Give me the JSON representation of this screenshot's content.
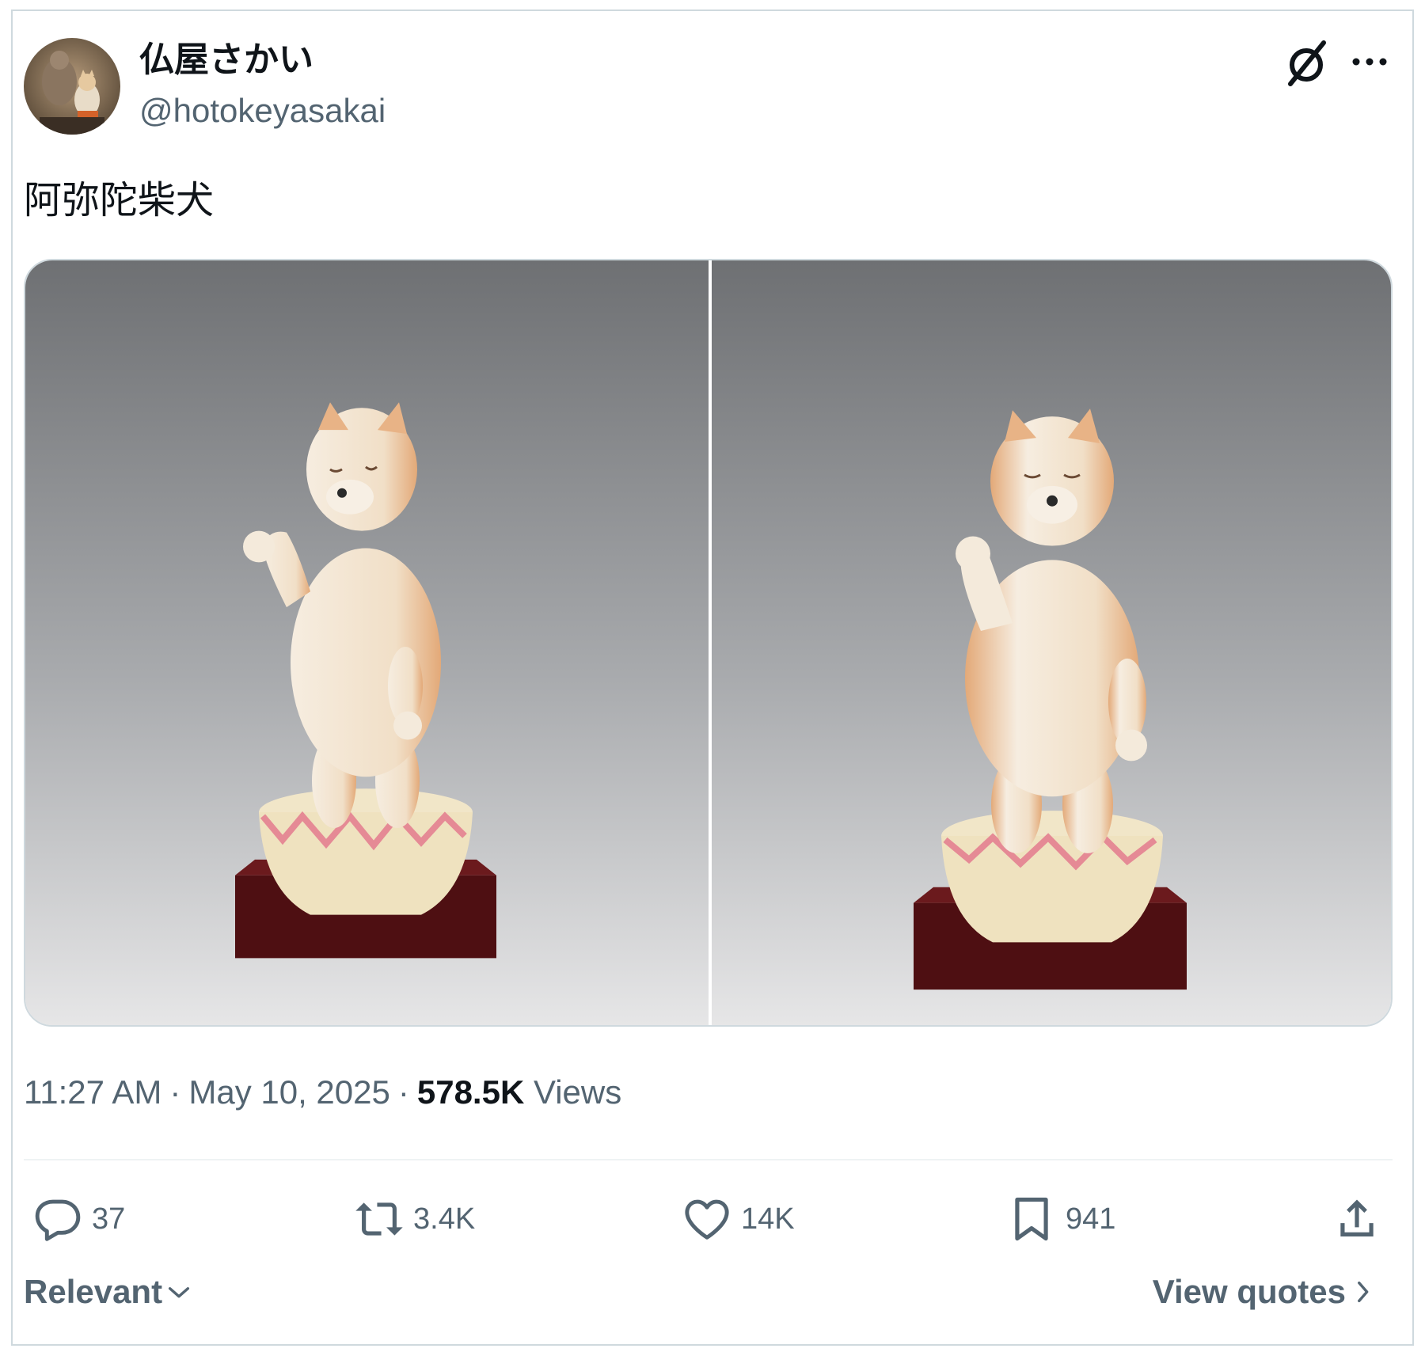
{
  "author": {
    "display_name": "仏屋さかい",
    "handle": "@hotokeyasakai",
    "avatar_icon": "avatar-statue-icon"
  },
  "tweet": {
    "text": "阿弥陀柴犬",
    "time": "11:27 AM",
    "date": "May 10, 2025",
    "views_count": "578.5K",
    "views_label": "Views",
    "separator": "·"
  },
  "media": [
    {
      "icon": "shiba-statue-photo",
      "description_shown": false
    },
    {
      "icon": "shiba-statue-photo",
      "description_shown": false
    }
  ],
  "actions": {
    "replies": "37",
    "retweets": "3.4K",
    "likes": "14K",
    "bookmarks": "941"
  },
  "icons": {
    "grok": "grok-icon",
    "more": "more-icon",
    "reply": "reply-icon",
    "retweet": "retweet-icon",
    "like": "heart-icon",
    "bookmark": "bookmark-icon",
    "share": "share-icon"
  },
  "footer": {
    "sort_label": "Relevant",
    "quotes_label": "View quotes"
  },
  "colors": {
    "text_primary": "#0f1419",
    "text_secondary": "#536471",
    "border": "#cfd9de"
  }
}
